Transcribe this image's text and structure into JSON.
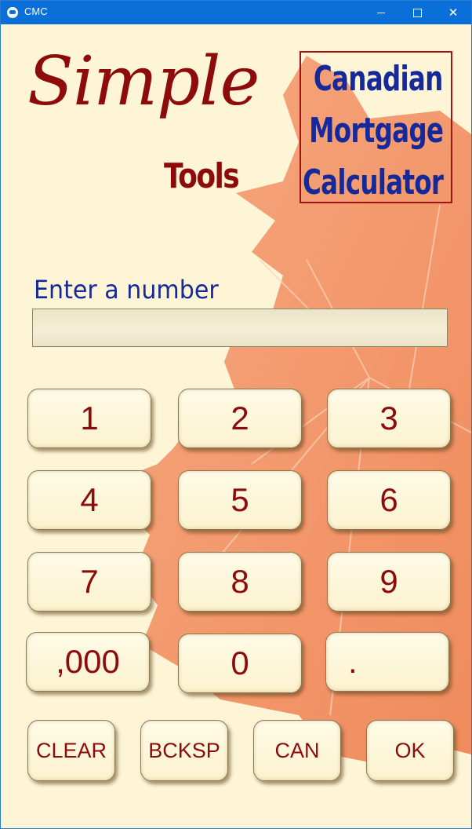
{
  "window": {
    "title": "CMC"
  },
  "branding": {
    "simple": "Simple",
    "tools": "Tools",
    "cmc_line1": "Canadian",
    "cmc_line2": "Mortgage",
    "cmc_line3": "Calculator"
  },
  "prompt": {
    "label": "Enter a number",
    "value": ""
  },
  "keypad": {
    "k1": "1",
    "k2": "2",
    "k3": "3",
    "k4": "4",
    "k5": "5",
    "k6": "6",
    "k7": "7",
    "k8": "8",
    "k9": "9",
    "thousands": ",000",
    "k0": "0",
    "decimal": "."
  },
  "actions": {
    "clear": "CLEAR",
    "backspace": "BCKSP",
    "cancel": "CAN",
    "ok": "OK"
  },
  "colors": {
    "background": "#fdf5d6",
    "titlebar": "#0a6fd8",
    "brand_red": "#8e0b0b",
    "brand_blue": "#16299a",
    "leaf": "#f08a5a"
  }
}
